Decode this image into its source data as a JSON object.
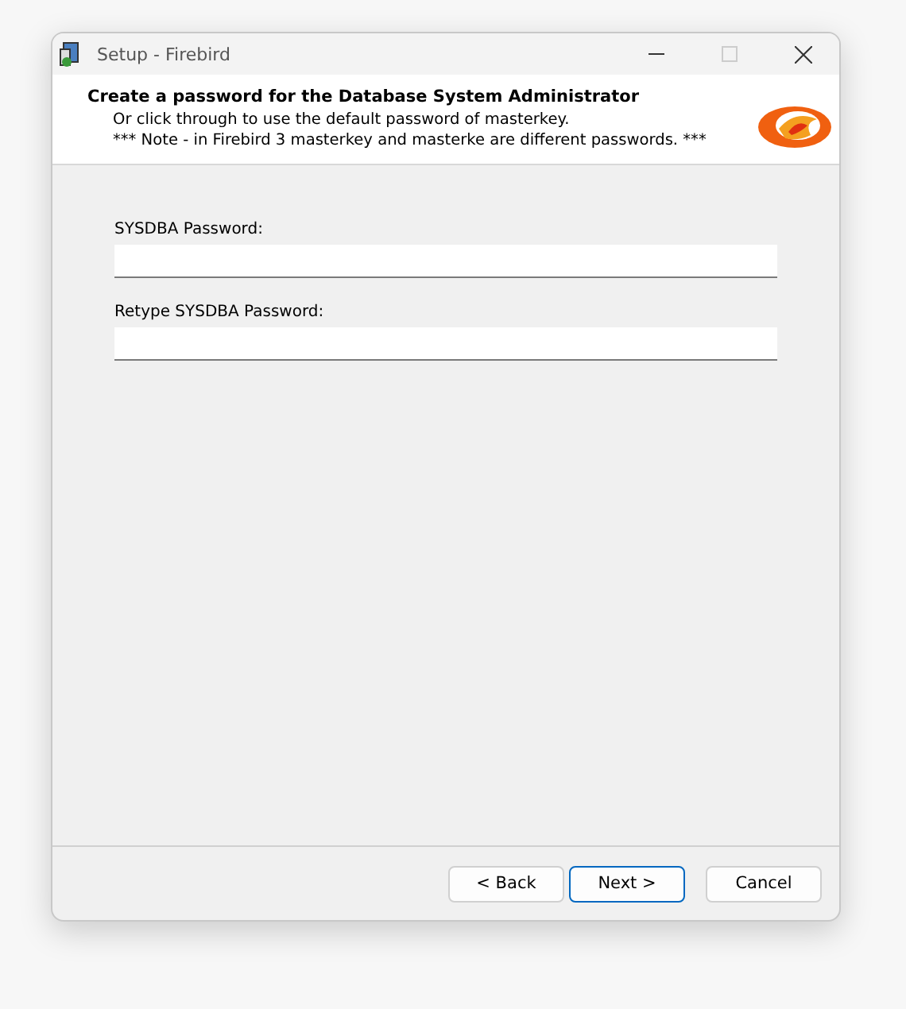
{
  "window": {
    "title": "Setup - Firebird"
  },
  "header": {
    "title": "Create a password for the Database System Administrator",
    "lines": [
      "Or click through to use the default password of masterkey.",
      "*** Note - in Firebird 3 masterkey and masterke are different passwords. ***"
    ]
  },
  "fields": [
    {
      "label": "SYSDBA Password:"
    },
    {
      "label": "Retype SYSDBA Password:"
    }
  ],
  "buttons": [
    {
      "label": "< Back",
      "default": false
    },
    {
      "label": "Next >",
      "default": true
    },
    {
      "label": "Cancel",
      "default": false
    }
  ]
}
